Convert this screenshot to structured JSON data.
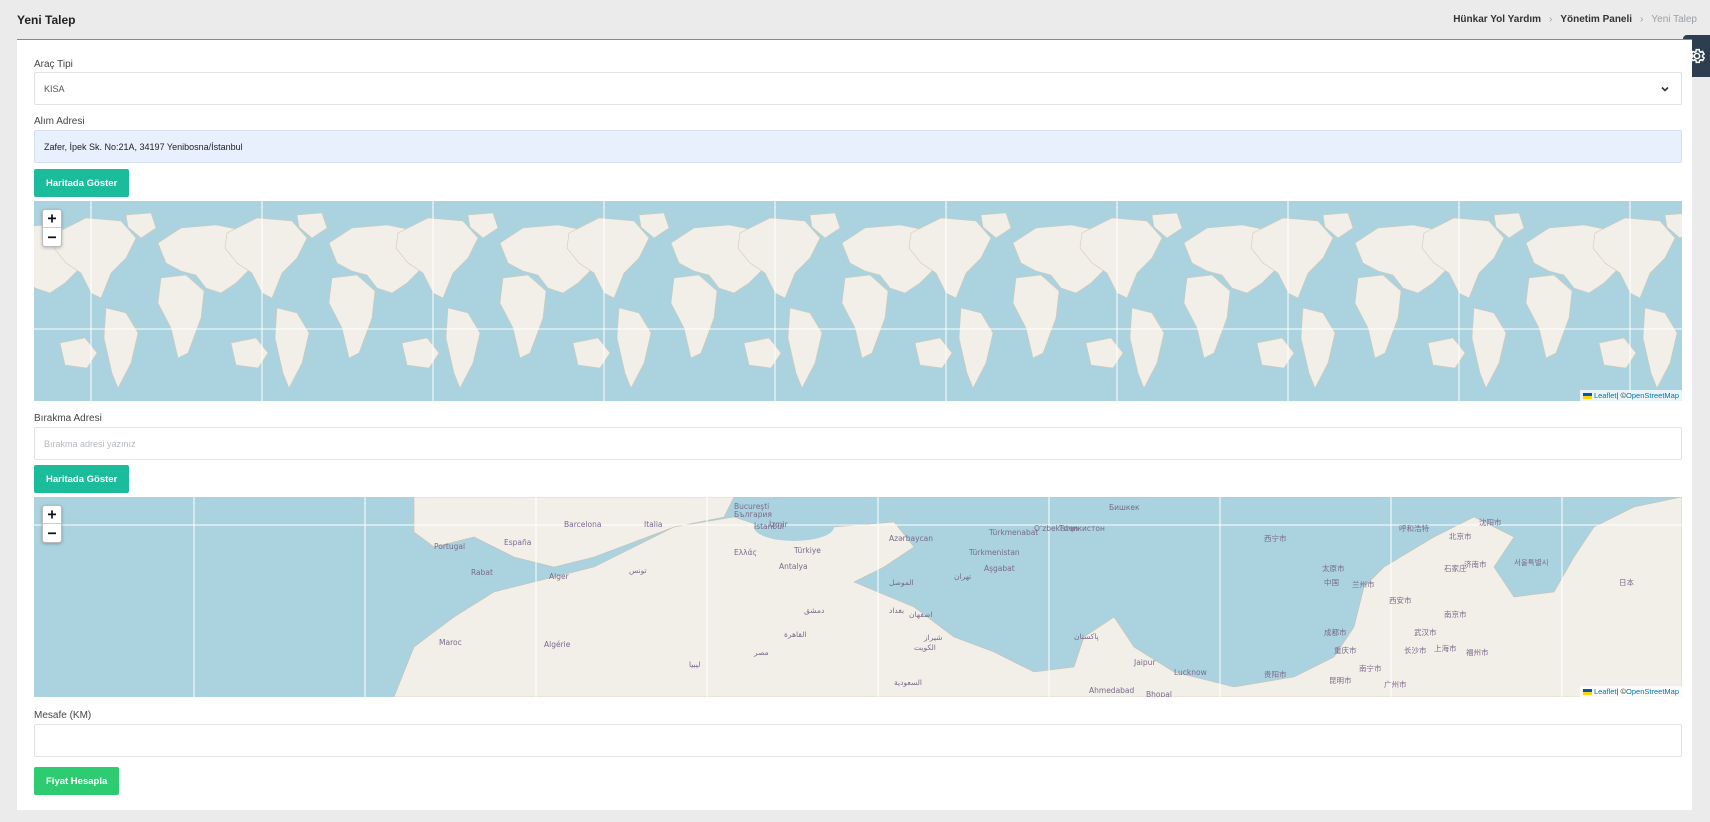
{
  "header": {
    "title": "Yeni Talep",
    "breadcrumb": [
      {
        "label": "Hünkar Yol Yardım"
      },
      {
        "label": "Yönetim Paneli"
      },
      {
        "label": "Yeni Talep"
      }
    ],
    "separator": "›"
  },
  "form": {
    "vehicle_type": {
      "label": "Araç Tipi",
      "value": "KISA"
    },
    "pickup": {
      "label": "Alım Adresi",
      "value": "Zafer, İpek Sk. No:21A, 34197 Yenibosna/İstanbul"
    },
    "pickup_button": "Haritada Göster",
    "dropoff": {
      "label": "Bırakma Adresi",
      "value": "",
      "placeholder": "Bırakma adresi yazınız"
    },
    "dropoff_button": "Haritada Göster",
    "distance": {
      "label": "Mesafe (KM)",
      "value": ""
    },
    "calc_button": "Fiyat Hesapla"
  },
  "map_controls": {
    "zoom_in": "+",
    "zoom_out": "−",
    "attribution_leaflet": "Leaflet",
    "attribution_sep": " | © ",
    "attribution_osm": "OpenStreetMap"
  },
  "map_labels": [
    "Bucureşti",
    "България",
    "Barcelona",
    "Italia",
    "İstanbul",
    "Azərbaycan",
    "Türkmenistan",
    "Oʻzbekiston",
    "Бишкек",
    "Portugal",
    "España",
    "Türkiye",
    "Antalya",
    "Aşgabat",
    "Rabat",
    "Alger",
    "تونس",
    "Ελλάς",
    "İzmir",
    "الموصل",
    "تهران",
    "Тоҷикистон",
    "呼和浩特",
    "北京市",
    "沈阳市",
    "西宁市",
    "中国",
    "兰州市",
    "西安市",
    "太原市",
    "石家庄",
    "济南市",
    "서울특별시",
    "日本",
    "Maroc",
    "Algérie",
    "مصر",
    "ليبيا",
    "دمشق",
    "بغداد",
    "اصفهان",
    "شیراز",
    "الكويت",
    "پاکستان",
    "Jaipur",
    "Lucknow",
    "Ahmedabad",
    "Bhopal",
    "成都市",
    "重庆市",
    "武汉市",
    "长沙市",
    "上海市",
    "南宁市",
    "广州市",
    "昆明市",
    "贵阳市",
    "福州市",
    "南京市",
    "Türkmenabat",
    "القاهرة",
    "السعودية"
  ],
  "colors": {
    "accent": "#1abc9c",
    "calc_button": "#2ecc71",
    "water": "#aad3df",
    "land": "#f2efe9",
    "autofill_bg": "#e8f0fe"
  },
  "icons": {
    "settings": "gear-icon",
    "select_arrow": "chevron-down-icon"
  }
}
